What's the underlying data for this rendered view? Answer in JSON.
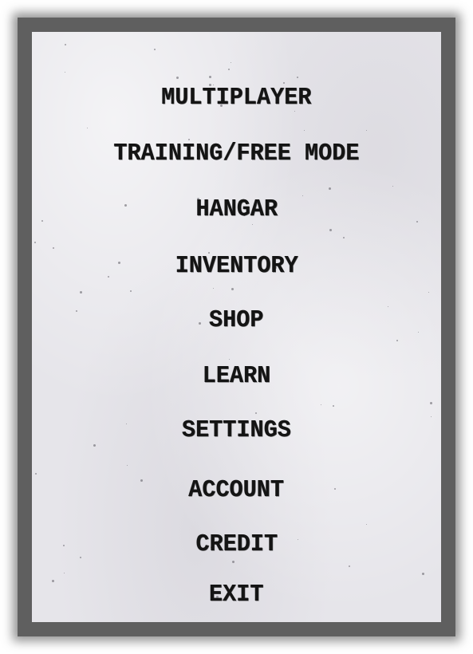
{
  "menu": {
    "items": [
      {
        "label": "MULTIPLAYER"
      },
      {
        "label": "TRAINING/FREE MODE"
      },
      {
        "label": "HANGAR"
      },
      {
        "label": "INVENTORY"
      },
      {
        "label": "SHOP"
      },
      {
        "label": "LEARN"
      },
      {
        "label": "SETTINGS"
      },
      {
        "label": "ACCOUNT"
      },
      {
        "label": "CREDIT"
      },
      {
        "label": "EXIT"
      }
    ]
  },
  "colors": {
    "frame": "#5f5f5f",
    "paper": "#e6e5ea",
    "text": "#141414"
  }
}
